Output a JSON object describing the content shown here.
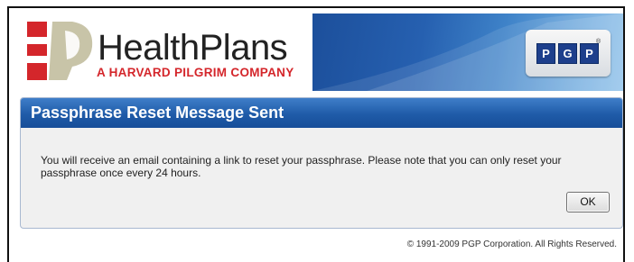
{
  "header": {
    "logo_name": "HealthPlans",
    "logo_tagline": "A HARVARD PILGRIM COMPANY",
    "pgp_letters": [
      "P",
      "G",
      "P"
    ],
    "pgp_registered": "®"
  },
  "dialog": {
    "title": "Passphrase Reset Message Sent",
    "message": "You will receive an email containing a link to reset your passphrase.  Please note that you can only reset your passphrase once every 24 hours.",
    "ok_label": "OK"
  },
  "footer": {
    "copyright": "© 1991-2009 PGP Corporation. All Rights Reserved."
  },
  "colors": {
    "brand_red": "#d4262b",
    "brand_tan": "#c8c4a8",
    "title_bar_blue": "#1f5ba8",
    "pgp_blue": "#1d3f8c"
  },
  "icons": [
    "healthplans-logo-icon",
    "pgp-logo-icon"
  ]
}
